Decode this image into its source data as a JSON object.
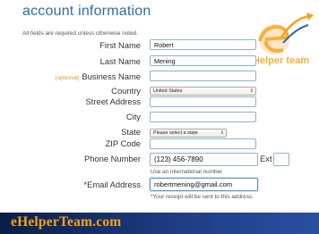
{
  "form": {
    "title": "account information",
    "required_note": "All fields are required unless otherwise noted.",
    "fields": {
      "first_name": {
        "label": "First Name",
        "value": "Robert"
      },
      "last_name": {
        "label": "Last Name",
        "value": "Mening"
      },
      "business_name": {
        "optional_tag": "(optional)",
        "label": " Business Name",
        "value": ""
      },
      "country": {
        "label": "Country",
        "value": "United States"
      },
      "street_address": {
        "label": "Street Address",
        "value": ""
      },
      "city": {
        "label": "City",
        "value": ""
      },
      "state": {
        "label": "State",
        "value": "Please select a state"
      },
      "zip_code": {
        "label": "ZIP Code",
        "value": ""
      },
      "phone_number": {
        "label": "Phone Number",
        "value": "(123) 456-7890",
        "hint": "Use an international number"
      },
      "ext": {
        "label": "Ext",
        "value": ""
      },
      "email": {
        "label": "*Email Address",
        "value": "robertmening@gmail.com",
        "hint": "*Your receipt will be sent to this address."
      }
    }
  },
  "watermark": {
    "text": "eHelper team",
    "brand_color": "#f4a21a"
  },
  "footer": {
    "text": "eHelperTeam.com",
    "text_color": "#f4a21a",
    "bg_color": "#1a3575"
  },
  "colors": {
    "accent": "#2f6ea6",
    "input_border": "#8fb1cf"
  }
}
